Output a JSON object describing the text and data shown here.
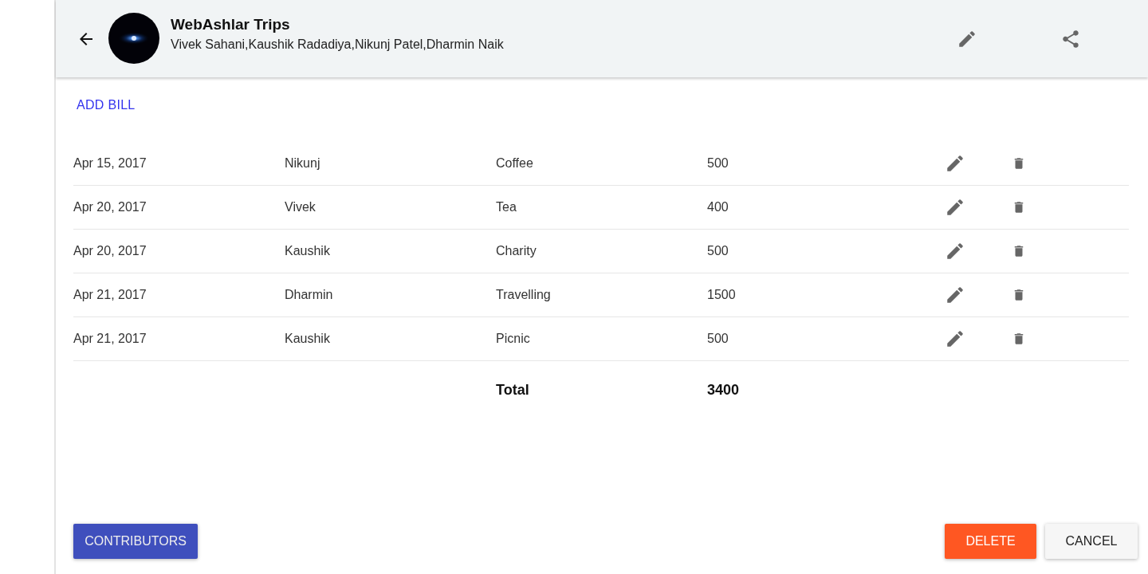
{
  "header": {
    "title": "WebAshlar Trips",
    "members": "Vivek Sahani,Kaushik Radadiya,Nikunj Patel,Dharmin Naik"
  },
  "add_bill": "ADD BILL",
  "bills": [
    {
      "date": "Apr 15, 2017",
      "person": "Nikunj",
      "item": "Coffee",
      "amount": "500"
    },
    {
      "date": "Apr 20, 2017",
      "person": "Vivek",
      "item": "Tea",
      "amount": "400"
    },
    {
      "date": "Apr 20, 2017",
      "person": "Kaushik",
      "item": "Charity",
      "amount": "500"
    },
    {
      "date": "Apr 21, 2017",
      "person": "Dharmin",
      "item": "Travelling",
      "amount": "1500"
    },
    {
      "date": "Apr 21, 2017",
      "person": "Kaushik",
      "item": "Picnic",
      "amount": "500"
    }
  ],
  "total": {
    "label": "Total",
    "amount": "3400"
  },
  "buttons": [
    {
      "label": "CONTRIBUTORS",
      "kind": "primary"
    },
    {
      "label": "DELETE",
      "kind": "danger"
    },
    {
      "label": "CANCEL",
      "kind": "plain"
    }
  ]
}
